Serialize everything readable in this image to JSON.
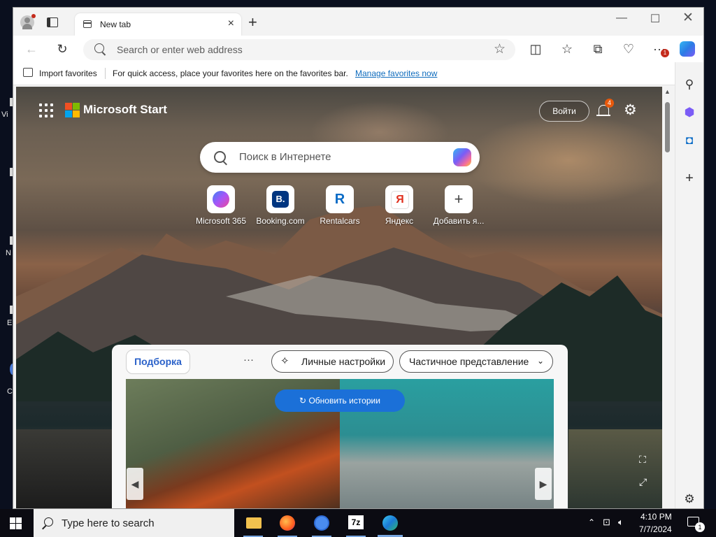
{
  "desktop": {
    "labels": [
      "Vi",
      "N",
      "E",
      "C"
    ]
  },
  "browser": {
    "tab_title": "New tab",
    "address_placeholder": "Search or enter web address",
    "favbar": {
      "import": "Import favorites",
      "hint": "For quick access, place your favorites here on the favorites bar.",
      "manage": "Manage favorites now"
    },
    "notification_badge": "1"
  },
  "start_page": {
    "brand": "Microsoft Start",
    "signin": "Войти",
    "bell_badge": "4",
    "search_placeholder": "Поиск в Интернете",
    "quick_links": [
      {
        "label": "Microsoft 365",
        "icon": "m365-icon"
      },
      {
        "label": "Booking.com",
        "icon": "booking-icon",
        "glyph": "B."
      },
      {
        "label": "Rentalcars",
        "icon": "rentalcars-icon",
        "glyph": "R"
      },
      {
        "label": "Яндекс",
        "icon": "yandex-icon",
        "glyph": "Я"
      },
      {
        "label": "Добавить я...",
        "icon": "plus-icon",
        "glyph": "+"
      }
    ],
    "feed": {
      "tab": "Подборка",
      "more": "···",
      "personalize": "Личные настройки",
      "view": "Частичное представление",
      "refresh": "Обновить истории"
    }
  },
  "taskbar": {
    "search_placeholder": "Type here to search",
    "time": "4:10 PM",
    "date": "7/7/2024",
    "notification_count": "1"
  },
  "colors": {
    "accent": "#0f6cbd",
    "refresh_button": "#1b70d8",
    "badge_orange": "#e8590c",
    "badge_red": "#c42b1c"
  }
}
